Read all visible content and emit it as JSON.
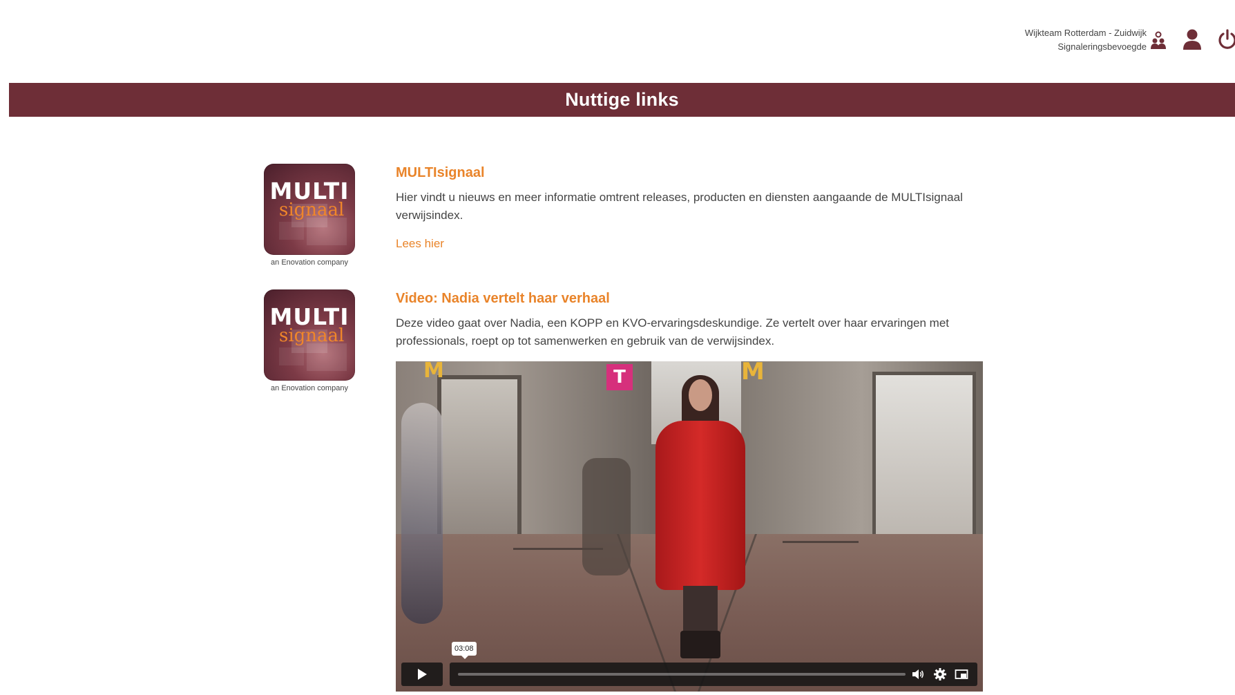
{
  "header": {
    "team_name": "Wijkteam Rotterdam - Zuidwijk",
    "role": "Signaleringsbevoegde",
    "icons": {
      "team": "team-icon",
      "profile": "person-icon",
      "logout": "power-icon"
    }
  },
  "page_title": "Nuttige links",
  "colors": {
    "brand": "#6e2e37",
    "accent": "#e9842a"
  },
  "links": [
    {
      "logo_word": "MULTI",
      "logo_sub": "signaal",
      "logo_caption": "an Enovation company",
      "title": "MULTIsignaal",
      "description": "Hier vindt u nieuws en meer informatie omtrent releases, producten en diensten aangaande de MULTIsignaal verwijsindex.",
      "link_label": "Lees hier"
    },
    {
      "logo_word": "MULTI",
      "logo_sub": "signaal",
      "logo_caption": "an Enovation company",
      "title": "Video: Nadia vertelt haar verhaal",
      "description": "Deze video gaat over Nadia, een KOPP en KVO-ervaringsdeskundige. Ze vertelt over haar ervaringen met professionals, roept op tot samenwerken en gebruik van de verwijsindex.",
      "video": {
        "duration": "03:08",
        "progress_fraction": 0,
        "sign_letter": "T"
      }
    }
  ]
}
